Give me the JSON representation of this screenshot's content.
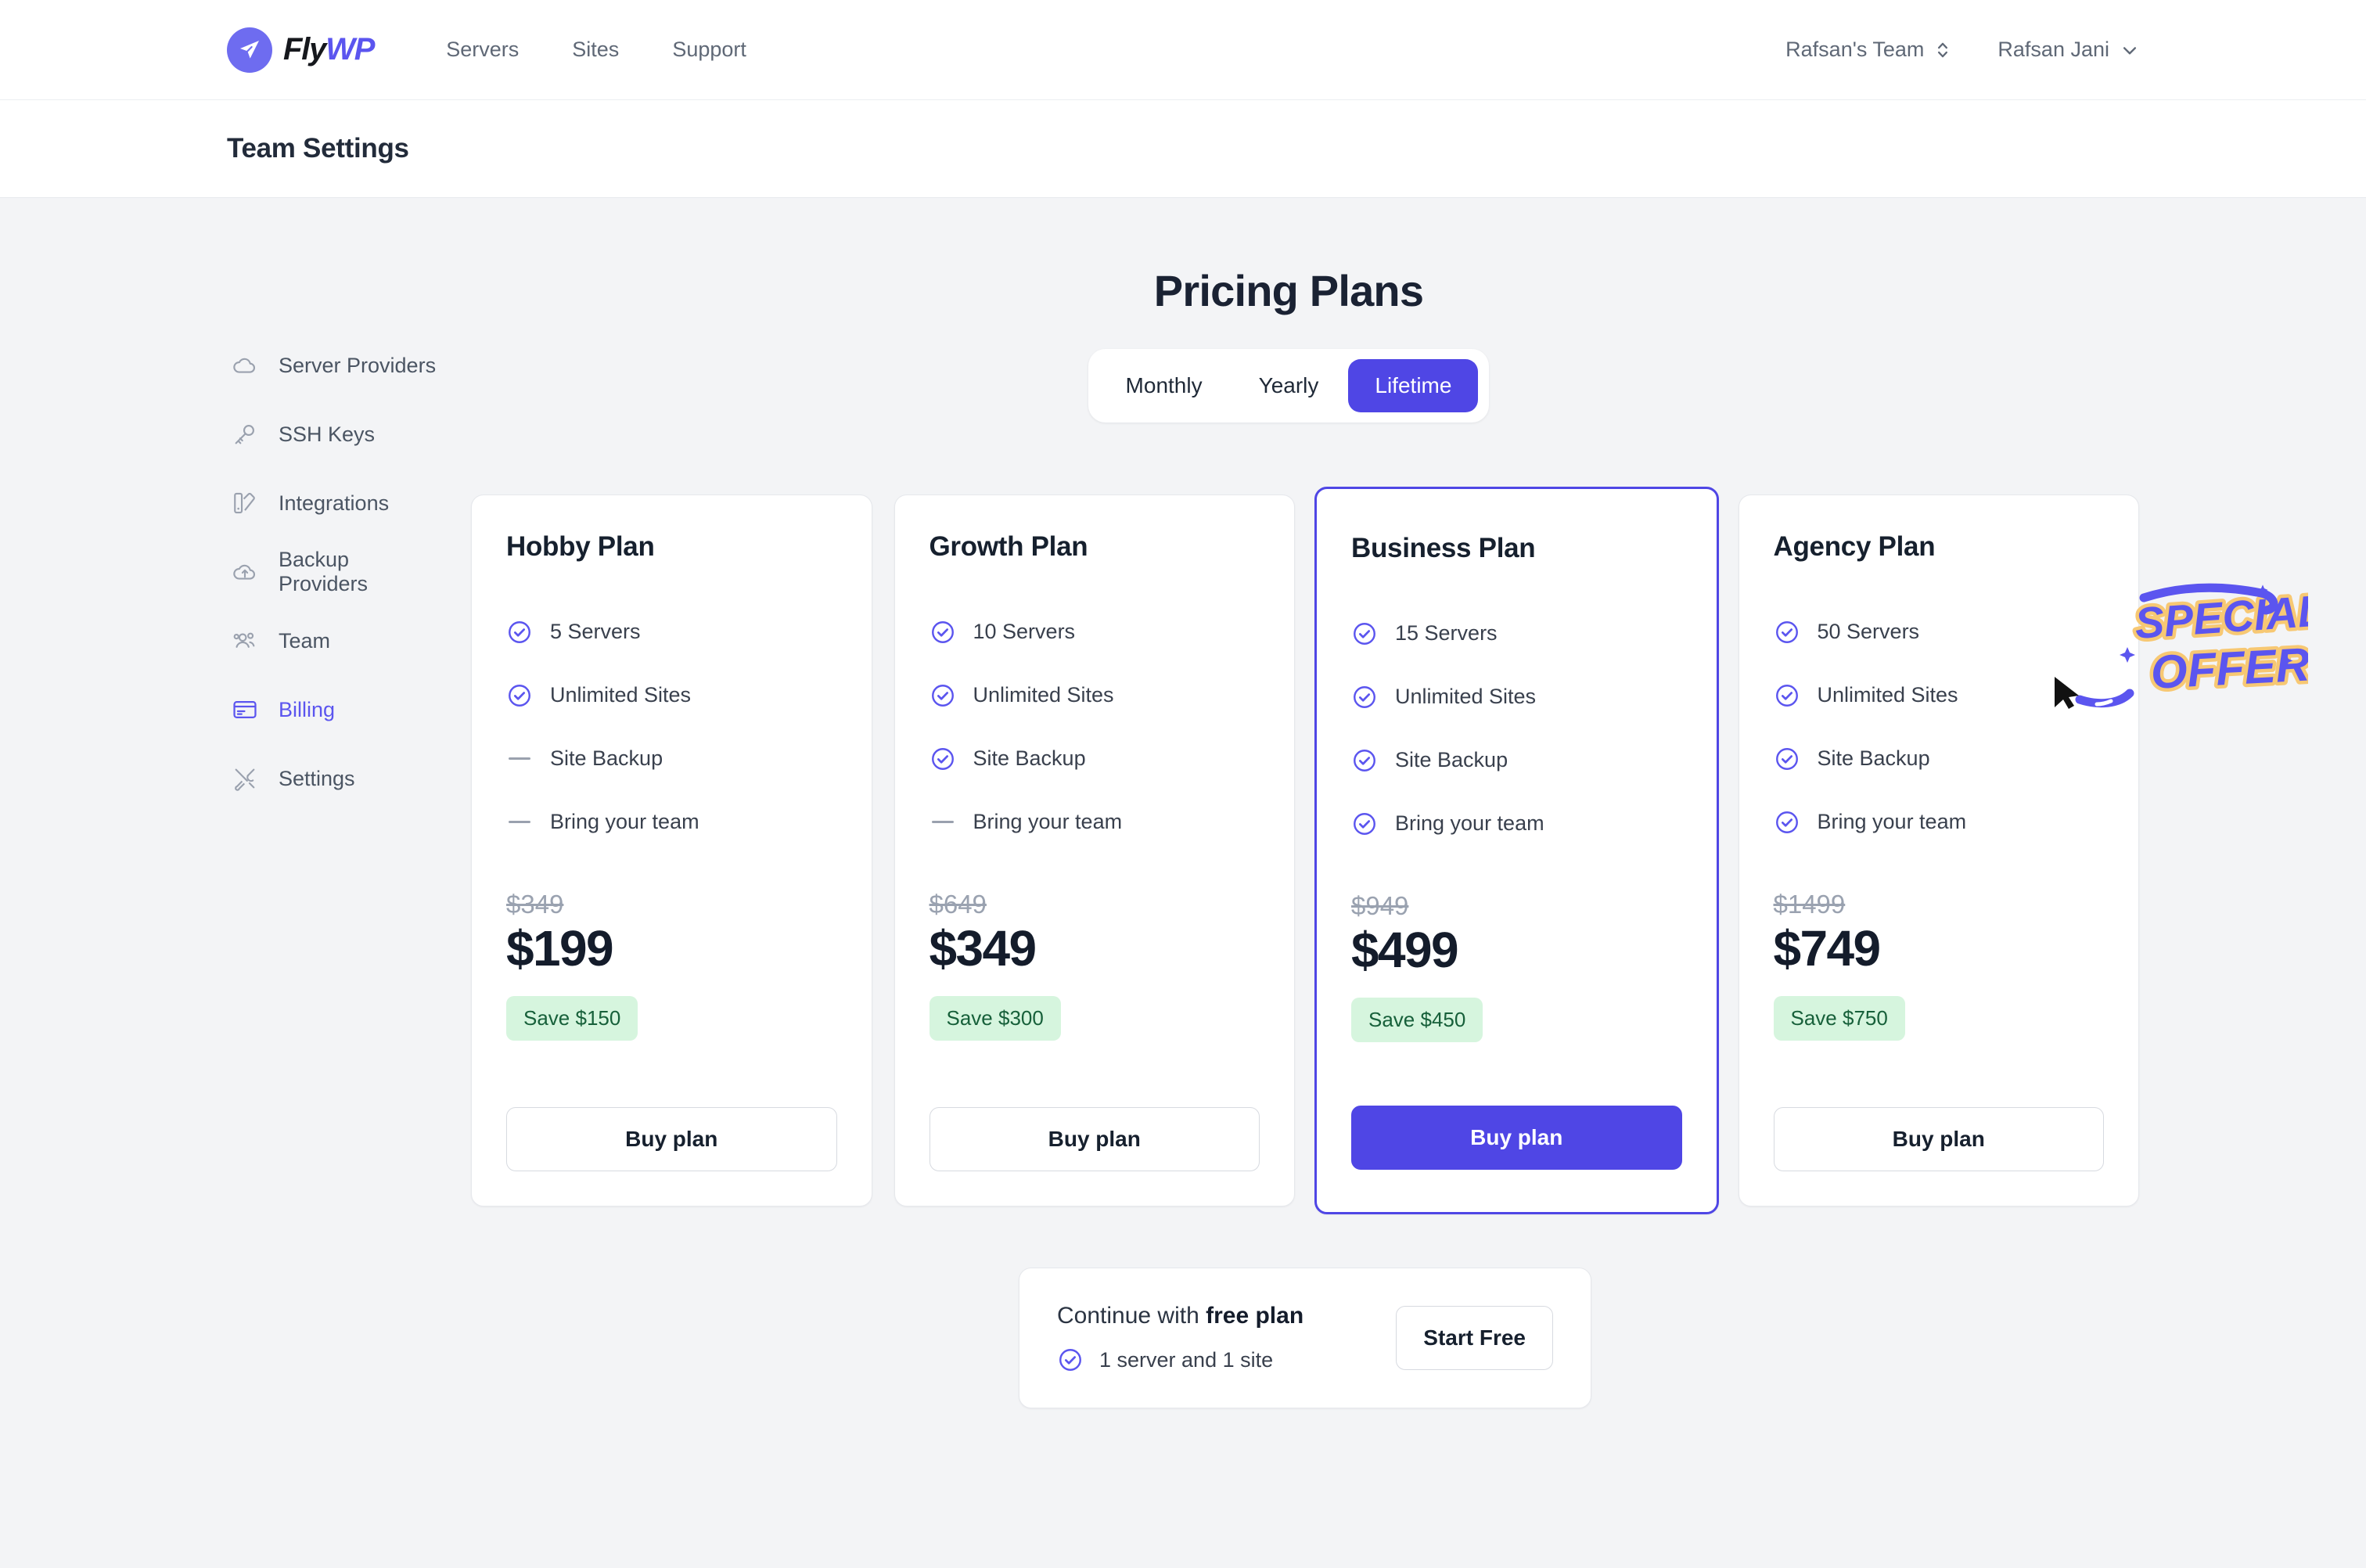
{
  "brand": {
    "name_part1": "Fly",
    "name_part2": "WP",
    "logo_icon": "paper-plane-icon"
  },
  "topnav": {
    "links": [
      {
        "label": "Servers"
      },
      {
        "label": "Sites"
      },
      {
        "label": "Support"
      }
    ],
    "team_switcher": {
      "label": "Rafsan's Team",
      "icon": "chevron-up-down-icon"
    },
    "user_menu": {
      "label": "Rafsan Jani",
      "icon": "chevron-down-icon"
    }
  },
  "header": {
    "title": "Team Settings"
  },
  "sidebar": {
    "items": [
      {
        "label": "Server Providers",
        "icon": "cloud-icon",
        "active": false
      },
      {
        "label": "SSH Keys",
        "icon": "key-icon",
        "active": false
      },
      {
        "label": "Integrations",
        "icon": "integrations-icon",
        "active": false
      },
      {
        "label": "Backup Providers",
        "icon": "cloud-upload-icon",
        "active": false
      },
      {
        "label": "Team",
        "icon": "users-icon",
        "active": false
      },
      {
        "label": "Billing",
        "icon": "credit-card-icon",
        "active": true
      },
      {
        "label": "Settings",
        "icon": "tools-icon",
        "active": false
      }
    ]
  },
  "pricing": {
    "title": "Pricing Plans",
    "billing_cycles": [
      {
        "label": "Monthly",
        "selected": false
      },
      {
        "label": "Yearly",
        "selected": false
      },
      {
        "label": "Lifetime",
        "selected": true
      }
    ],
    "sticker": {
      "line1": "SPECIAL",
      "line2": "OFFER",
      "arrow_icon": "curved-arrow-cursor-icon",
      "color": "#5b55ef",
      "outline_color": "#f7c873"
    },
    "plans": [
      {
        "name": "Hobby Plan",
        "features": [
          {
            "label": "5 Servers",
            "included": true
          },
          {
            "label": "Unlimited Sites",
            "included": true
          },
          {
            "label": "Site Backup",
            "included": false
          },
          {
            "label": "Bring your team",
            "included": false
          }
        ],
        "old_price": "$349",
        "price": "$199",
        "save": "Save $150",
        "cta": "Buy plan",
        "featured": false
      },
      {
        "name": "Growth Plan",
        "features": [
          {
            "label": "10 Servers",
            "included": true
          },
          {
            "label": "Unlimited Sites",
            "included": true
          },
          {
            "label": "Site Backup",
            "included": true
          },
          {
            "label": "Bring your team",
            "included": false
          }
        ],
        "old_price": "$649",
        "price": "$349",
        "save": "Save $300",
        "cta": "Buy plan",
        "featured": false
      },
      {
        "name": "Business Plan",
        "features": [
          {
            "label": "15 Servers",
            "included": true
          },
          {
            "label": "Unlimited Sites",
            "included": true
          },
          {
            "label": "Site Backup",
            "included": true
          },
          {
            "label": "Bring your team",
            "included": true
          }
        ],
        "old_price": "$949",
        "price": "$499",
        "save": "Save $450",
        "cta": "Buy plan",
        "featured": true
      },
      {
        "name": "Agency Plan",
        "features": [
          {
            "label": "50 Servers",
            "included": true
          },
          {
            "label": "Unlimited Sites",
            "included": true
          },
          {
            "label": "Site Backup",
            "included": true
          },
          {
            "label": "Bring your team",
            "included": true
          }
        ],
        "old_price": "$1499",
        "price": "$749",
        "save": "Save $750",
        "cta": "Buy plan",
        "featured": false
      }
    ]
  },
  "free_plan": {
    "prefix": "Continue with ",
    "emphasis": "free plan",
    "detail": "1 server and 1 site",
    "cta": "Start Free"
  },
  "colors": {
    "accent": "#4f46e5",
    "accent_light": "#6e6cf0",
    "save_bg": "#d6f5de",
    "save_text": "#17603a",
    "page_bg": "#f3f4f6",
    "card_bg": "#ffffff"
  }
}
